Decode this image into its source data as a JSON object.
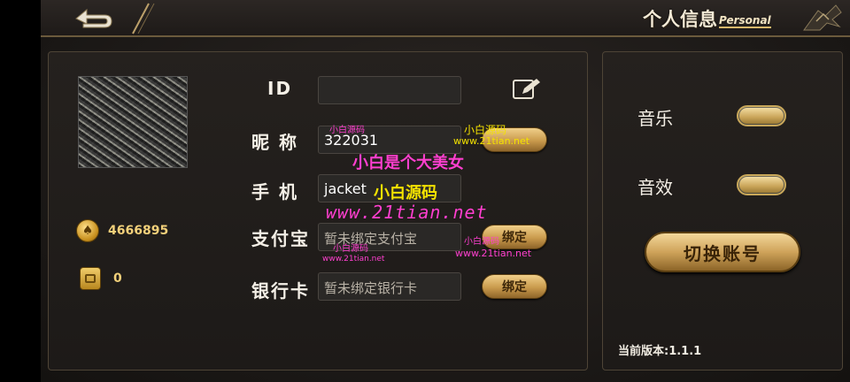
{
  "header": {
    "title_cn": "个人信息",
    "title_en": "Personal"
  },
  "profile": {
    "gold_value": "4666895",
    "card_value": "0"
  },
  "fields": {
    "id_label": "ID",
    "id_value": "",
    "nickname_label": "昵 称",
    "nickname_value": "322031",
    "phone_label": "手 机",
    "phone_value": "jacket",
    "alipay_label": "支付宝",
    "alipay_placeholder": "暂未绑定支付宝",
    "bank_label": "银行卡",
    "bank_placeholder": "暂未绑定银行卡",
    "bind_label": "绑定"
  },
  "settings": {
    "music_label": "音乐",
    "sfx_label": "音效",
    "switch_account_label": "切换账号",
    "version_text": "当前版本:1.1.1"
  },
  "watermarks": {
    "site_cn": "小白源码",
    "site_cn_small": "小白源码",
    "site_url": "www.21tian.net",
    "slogan": "小白是个大美女",
    "big_url": "www.21tian.net"
  },
  "colors": {
    "gold_accent": "#c99a4c",
    "panel_bg": "#221e1b",
    "watermark_pink": "#ff3fcf",
    "watermark_yellow": "#f4e200"
  }
}
